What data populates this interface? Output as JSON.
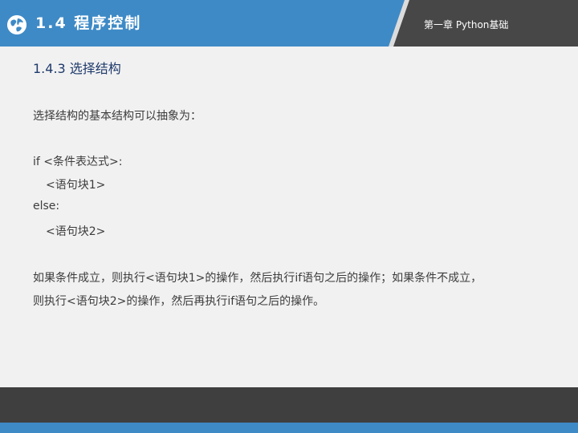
{
  "header": {
    "section_title": "1.4  程序控制",
    "chapter_label": "第一章 Python基础",
    "accent_color": "#3e8ac6",
    "dark_panel_color": "#474747",
    "icon": "globe-icon"
  },
  "content": {
    "subheading": "1.4.3  选择结构",
    "intro": "选择结构的基本结构可以抽象为：",
    "code_lines": [
      "if <条件表达式>:",
      "<语句块1>",
      "else:",
      "<语句块2>"
    ],
    "explanation_lines": [
      "如果条件成立，则执行<语句块1>的操作，然后执行if语句之后的操作；如果条件不成立，",
      "则执行<语句块2>的操作，然后再执行if语句之后的操作。"
    ]
  },
  "footer": {
    "dark_color": "#3f3f3f",
    "accent_color": "#3e8ac6"
  }
}
